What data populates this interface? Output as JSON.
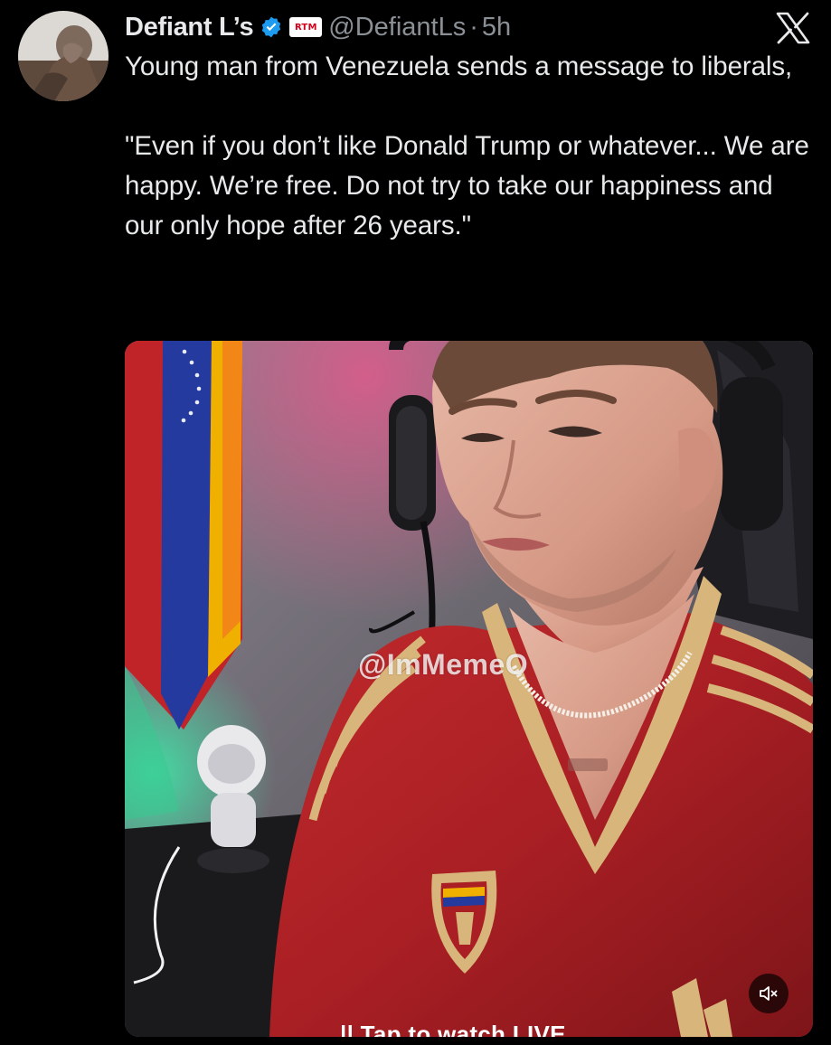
{
  "author": {
    "display_name": "Defiant L’s",
    "handle": "@DefiantLs",
    "separator": "·",
    "time": "5h",
    "affiliate_badge_text": "RTM",
    "verified_icon": "verified-badge-icon",
    "verified_color": "#1d9bf0"
  },
  "post": {
    "text": "Young man from Venezuela sends a message to liberals,\n\n\"Even if you don’t like Donald Trump or whatever... We are happy. We’re free. Do not try to take our happiness and our only hope after 26 years.\""
  },
  "media": {
    "watermark": "@ImMemeO",
    "overlay_text": "|| Tap to watch LIVE",
    "mute_icon": "speaker-muted-icon",
    "jersey_color": "#a91f24",
    "trim_color": "#d8b57a"
  },
  "brand": {
    "logo_icon": "x-logo-icon",
    "background": "#000000",
    "text_color": "#e7e9ea",
    "muted_text": "#8b9096"
  }
}
